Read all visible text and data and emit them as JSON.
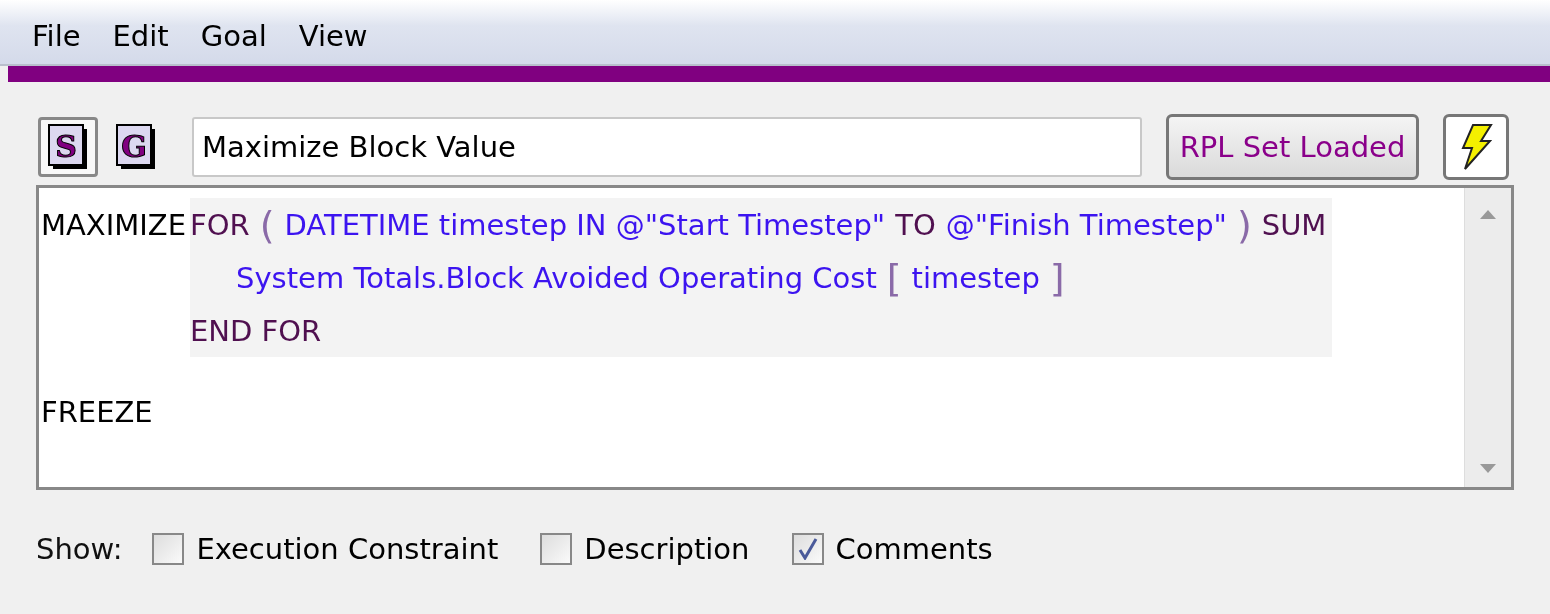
{
  "menu": [
    "File",
    "Edit",
    "Goal",
    "View"
  ],
  "toolbar": {
    "buttons": [
      {
        "letter": "S",
        "pressed": true
      },
      {
        "letter": "G",
        "pressed": false
      }
    ],
    "title_value": "Maximize Block Value",
    "status_button": "RPL Set Loaded"
  },
  "editor": {
    "statements": [
      {
        "keyword": "MAXIMIZE",
        "lines": [
          {
            "kind": "clause",
            "tokens": [
              {
                "text": "FOR",
                "kind": "keyword"
              },
              {
                "text": "(",
                "kind": "bracket"
              },
              {
                "text": "DATETIME timestep IN @\"Start Timestep\"",
                "kind": "operand"
              },
              {
                "text": "TO",
                "kind": "keyword"
              },
              {
                "text": "@\"Finish Timestep\"",
                "kind": "operand"
              },
              {
                "text": ")",
                "kind": "bracket"
              },
              {
                "text": "SUM",
                "kind": "keyword"
              }
            ]
          },
          {
            "kind": "inner",
            "tokens": [
              {
                "text": "System Totals.Block Avoided Operating Cost",
                "kind": "operand"
              },
              {
                "text": "[",
                "kind": "bracket"
              },
              {
                "text": "timestep",
                "kind": "operand"
              },
              {
                "text": "]",
                "kind": "bracket"
              }
            ]
          },
          {
            "kind": "clause",
            "tokens": [
              {
                "text": "END FOR",
                "kind": "keyword"
              }
            ]
          }
        ]
      },
      {
        "keyword": "FREEZE"
      }
    ]
  },
  "show": {
    "label": "Show:",
    "options": [
      {
        "label": "Execution Constraint",
        "checked": false
      },
      {
        "label": "Description",
        "checked": false
      },
      {
        "label": "Comments",
        "checked": true
      }
    ]
  }
}
